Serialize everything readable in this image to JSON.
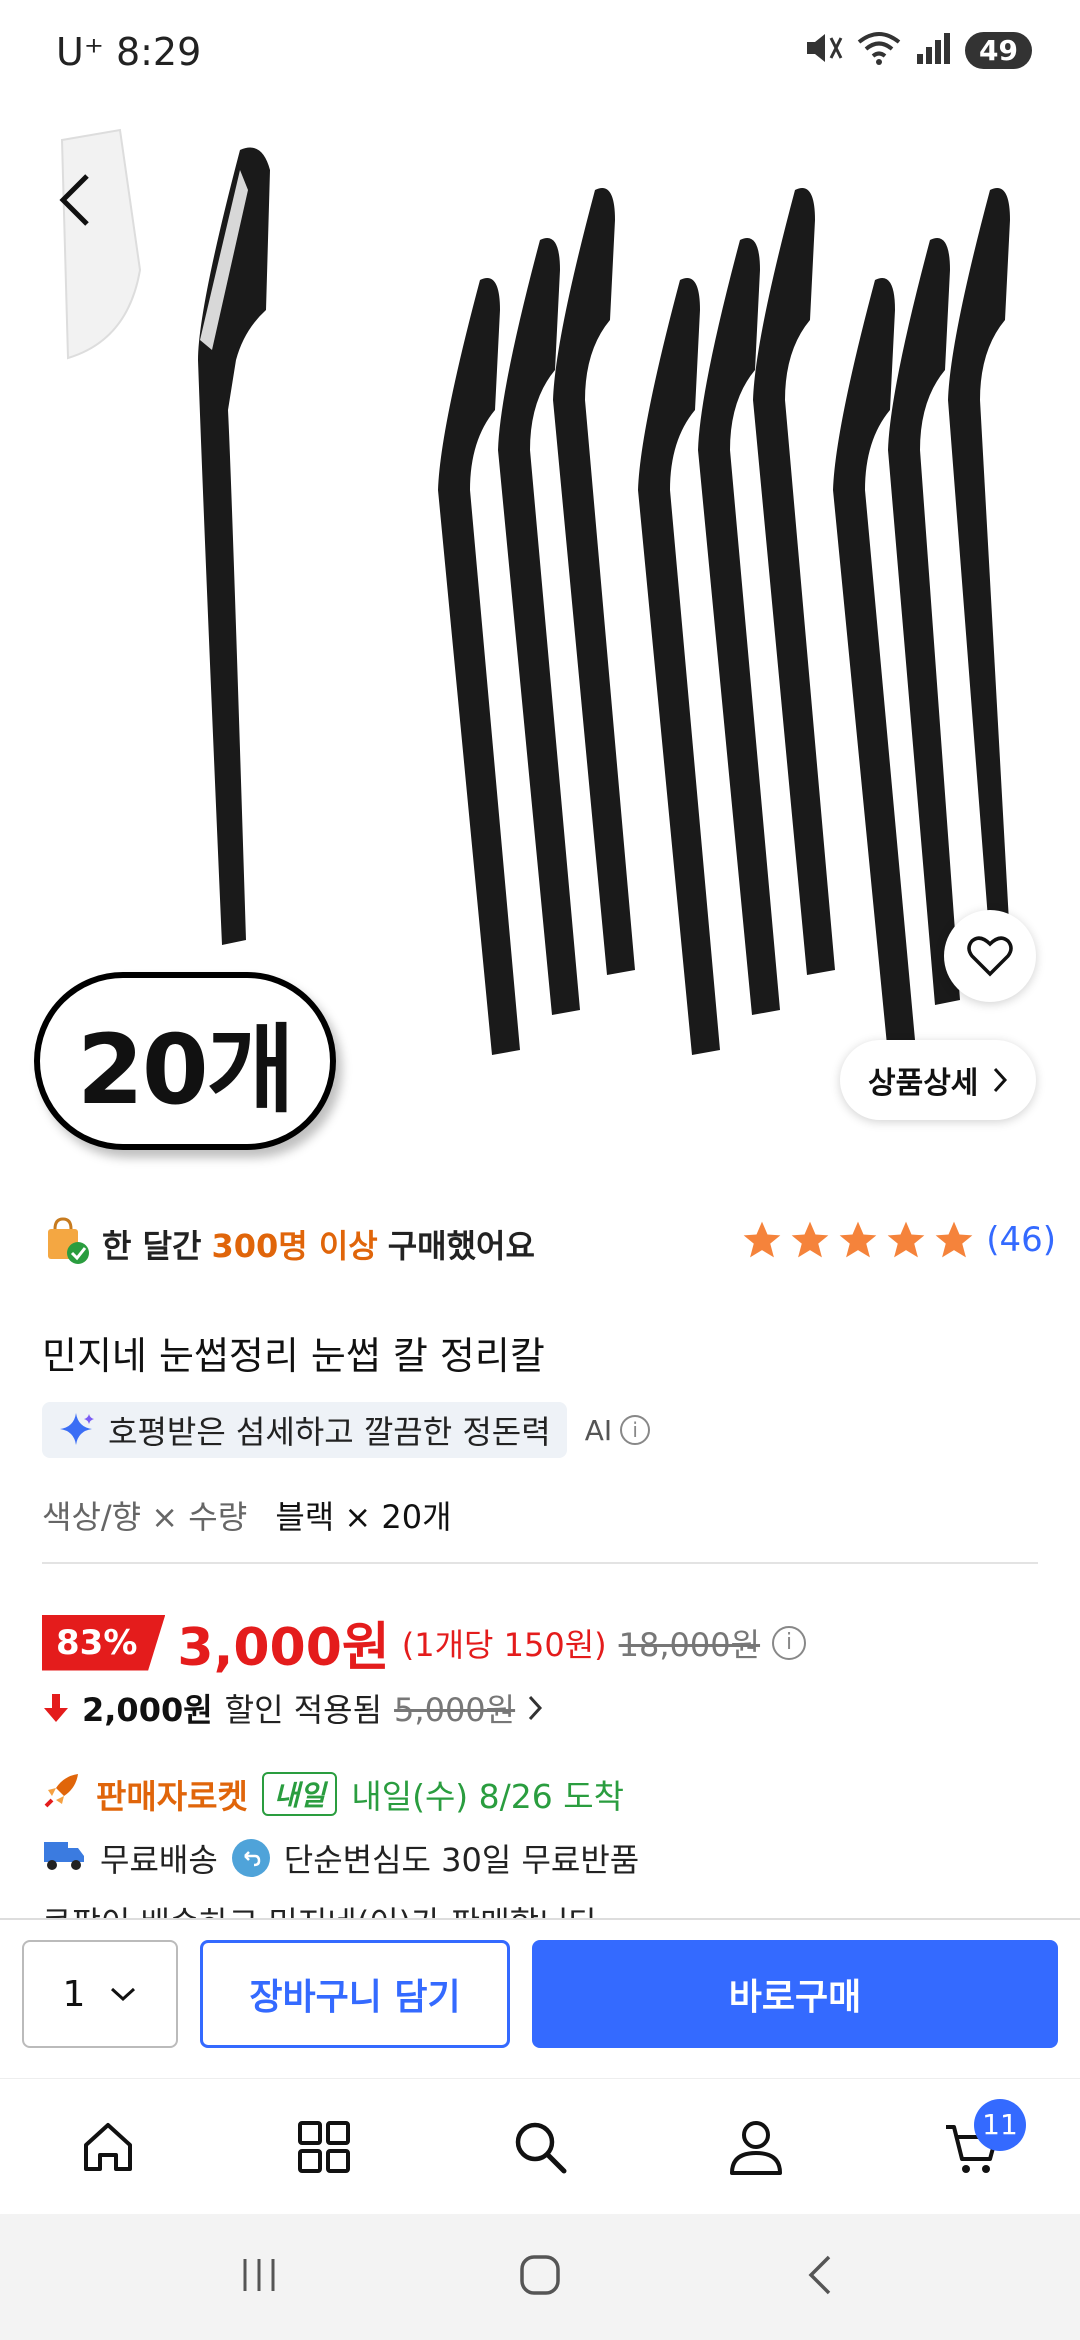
{
  "status_bar": {
    "carrier_time": "U⁺ 8:29",
    "battery": "49"
  },
  "hero": {
    "count_badge": "20개",
    "detail_button": "상품상세",
    "page_dots": 4,
    "active_dot": 0
  },
  "summary": {
    "purchase_prefix": "한 달간",
    "purchase_highlight": "300명 이상",
    "purchase_suffix": "구매했어요",
    "review_count": "(46)",
    "rating_stars": 5
  },
  "product": {
    "title": "민지네 눈썹정리 눈썹 칼 정리칼",
    "ai_summary": "호평받은 섬세하고 깔끔한 정돈력",
    "ai_label": "AI",
    "option_label": "색상/향 × 수량",
    "option_value": "블랙 × 20개"
  },
  "price": {
    "discount": "83%",
    "sale_price": "3,000원",
    "unit_price": "(1개당 150원)",
    "original_price": "18,000원",
    "coupon_amount": "2,000원",
    "coupon_text": "할인 적용됨",
    "coupon_before": "5,000원"
  },
  "delivery": {
    "rocket_label": "판매자로켓",
    "tomorrow_badge": "내일",
    "arrival": "내일(수) 8/26 도착",
    "free_shipping": "무료배송",
    "free_return": "단순변심도 30일 무료반품",
    "cut_line": "쿠팡이 배송하고 민지네(이)가 판매합니다"
  },
  "action_bar": {
    "quantity": "1",
    "cart_button": "장바구니 담기",
    "buy_button": "바로구매"
  },
  "bottom_nav": {
    "cart_badge": "11"
  },
  "colors": {
    "brand_blue": "#346aff",
    "sale_red": "#e41c1c",
    "rocket_orange": "#e0650a",
    "arrival_green": "#2a9d3f"
  }
}
